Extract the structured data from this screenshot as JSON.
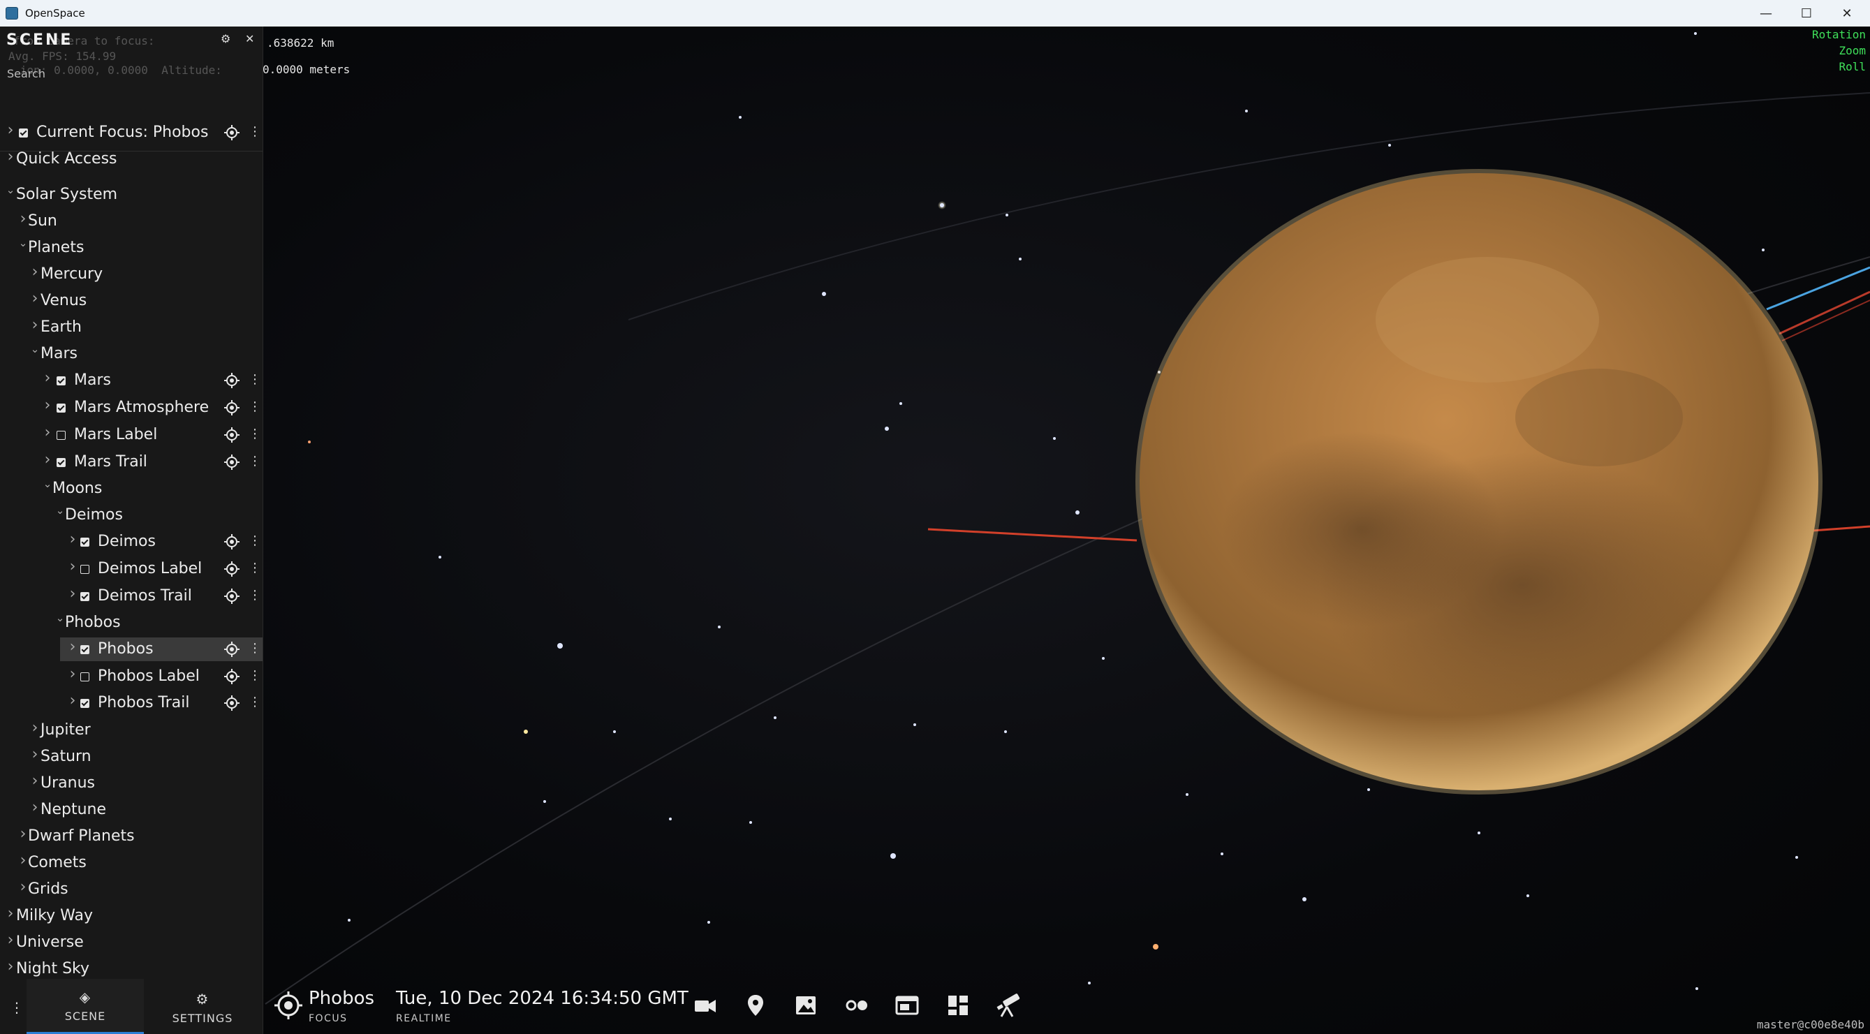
{
  "window": {
    "title": "OpenSpace"
  },
  "sidebar": {
    "title": "SCENE",
    "search_label": "Search",
    "overlay_line1": "  from camera to focus:",
    "overlay_line2": "Avg. FPS: 154.99",
    "overlay_line3": "   ion: 0.0000, 0.0000  Altitude:",
    "tree": [
      {
        "label": "Current Focus: Phobos",
        "level": 0,
        "chevron": "right",
        "checkbox": "on",
        "actions": true
      },
      {
        "label": "Quick Access",
        "level": 0,
        "chevron": "right"
      },
      {
        "label": "Solar System",
        "level": 0,
        "chevron": "down"
      },
      {
        "label": "Sun",
        "level": 1,
        "chevron": "right"
      },
      {
        "label": "Planets",
        "level": 1,
        "chevron": "down"
      },
      {
        "label": "Mercury",
        "level": 2,
        "chevron": "right"
      },
      {
        "label": "Venus",
        "level": 2,
        "chevron": "right"
      },
      {
        "label": "Earth",
        "level": 2,
        "chevron": "right"
      },
      {
        "label": "Mars",
        "level": 2,
        "chevron": "down"
      },
      {
        "label": "Mars",
        "level": 3,
        "chevron": "right",
        "checkbox": "on",
        "actions": true
      },
      {
        "label": "Mars Atmosphere",
        "level": 3,
        "chevron": "right",
        "checkbox": "on",
        "actions": true
      },
      {
        "label": "Mars Label",
        "level": 3,
        "chevron": "right",
        "checkbox": "off",
        "actions": true
      },
      {
        "label": "Mars Trail",
        "level": 3,
        "chevron": "right",
        "checkbox": "on",
        "actions": true
      },
      {
        "label": "Moons",
        "level": 3,
        "chevron": "down"
      },
      {
        "label": "Deimos",
        "level": 4,
        "chevron": "down"
      },
      {
        "label": "Deimos",
        "level": 5,
        "chevron": "right",
        "checkbox": "on",
        "actions": true
      },
      {
        "label": "Deimos Label",
        "level": 5,
        "chevron": "right",
        "checkbox": "off",
        "actions": true
      },
      {
        "label": "Deimos Trail",
        "level": 5,
        "chevron": "right",
        "checkbox": "on",
        "actions": true
      },
      {
        "label": "Phobos",
        "level": 4,
        "chevron": "down"
      },
      {
        "label": "Phobos",
        "level": 5,
        "chevron": "right",
        "checkbox": "on",
        "actions": true,
        "selected": true
      },
      {
        "label": "Phobos Label",
        "level": 5,
        "chevron": "right",
        "checkbox": "off",
        "actions": true
      },
      {
        "label": "Phobos Trail",
        "level": 5,
        "chevron": "right",
        "checkbox": "on",
        "actions": true
      },
      {
        "label": "Jupiter",
        "level": 2,
        "chevron": "right"
      },
      {
        "label": "Saturn",
        "level": 2,
        "chevron": "right"
      },
      {
        "label": "Uranus",
        "level": 2,
        "chevron": "right"
      },
      {
        "label": "Neptune",
        "level": 2,
        "chevron": "right"
      },
      {
        "label": "Dwarf Planets",
        "level": 1,
        "chevron": "right"
      },
      {
        "label": "Comets",
        "level": 1,
        "chevron": "right"
      },
      {
        "label": "Grids",
        "level": 1,
        "chevron": "right"
      },
      {
        "label": "Milky Way",
        "level": 0,
        "chevron": "right"
      },
      {
        "label": "Universe",
        "level": 0,
        "chevron": "right"
      },
      {
        "label": "Night Sky",
        "level": 0,
        "chevron": "right"
      }
    ],
    "tabs": [
      {
        "label": "SCENE",
        "icon": "layers-icon",
        "active": true
      },
      {
        "label": "SETTINGS",
        "icon": "gear-icon",
        "active": false
      }
    ]
  },
  "camera_info": {
    "distance": ".638622 km",
    "altitude": "0.0000 meters"
  },
  "nav_readout": {
    "rotation": "Rotation",
    "zoom": "Zoom",
    "roll": "Roll"
  },
  "bottom_bar": {
    "focus_name": "Phobos",
    "focus_sub": "FOCUS",
    "time": "Tue, 10 Dec 2024 16:34:50 GMT",
    "time_sub": "REALTIME",
    "tools": [
      "camera-icon",
      "location-pin-icon",
      "image-icon",
      "dots-icon",
      "window-icon",
      "dashboard-icon",
      "telescope-icon"
    ]
  },
  "version": "master@c00e8e40b",
  "colors": {
    "accent": "#2c7fd6",
    "nav_green": "#3fe05a",
    "mars": "#b07a3e",
    "trail_red": "#d2402a",
    "trail_blue": "#4aa3e0"
  }
}
